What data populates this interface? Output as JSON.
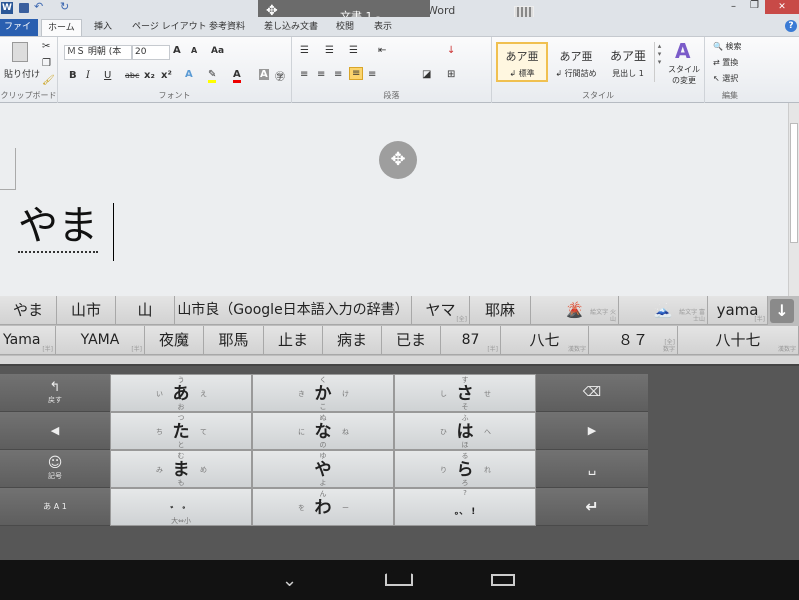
{
  "window": {
    "title": "文書 1 - Microsoft Word",
    "title_shadow": "文書 1 - Microsoft Word",
    "minimize": "–",
    "restore": "❐",
    "close": "✕",
    "help": "?"
  },
  "tabs": [
    {
      "label": "ファイル"
    },
    {
      "label": "ホーム"
    },
    {
      "label": "挿入"
    },
    {
      "label": "ページ レイアウト"
    },
    {
      "label": "参考資料"
    },
    {
      "label": "差し込み文書"
    },
    {
      "label": "校閲"
    },
    {
      "label": "表示"
    }
  ],
  "ribbon": {
    "clipboard": {
      "paste": "貼り付け",
      "label": "クリップボード"
    },
    "font": {
      "name": "ＭＳ 明朝 (本",
      "size": "20",
      "label": "フォント",
      "bold": "B",
      "italic": "I",
      "underline": "U",
      "strike": "abc",
      "sub": "x₂",
      "sup": "x²",
      "case": "Aa",
      "grow": "A",
      "shrink": "A"
    },
    "paragraph": {
      "label": "段落"
    },
    "styles": {
      "items": [
        {
          "sample": "あア亜",
          "name": "↲ 標準"
        },
        {
          "sample": "あア亜",
          "name": "↲ 行間詰め"
        },
        {
          "sample": "あア亜",
          "name": "見出し 1"
        }
      ],
      "change": "スタイルの変更",
      "label": "スタイル"
    },
    "editing": {
      "find": "検索",
      "replace": "置換",
      "select": "選択",
      "label": "編集"
    }
  },
  "document": {
    "text": "やま"
  },
  "candidates": {
    "row1": [
      {
        "text": "やま"
      },
      {
        "text": "山市"
      },
      {
        "text": "山"
      },
      {
        "text": "山市良（Google日本語入力の辞書）"
      },
      {
        "text": "ヤマ",
        "tag": "[全]"
      },
      {
        "text": "耶麻"
      },
      {
        "text": "🌋",
        "tag": "絵文字 火山"
      },
      {
        "text": "🗻",
        "tag": "絵文字 富士山"
      },
      {
        "text": "yama",
        "tag": "[半]"
      }
    ],
    "row2": [
      {
        "text": "Yama",
        "tag": "[半]"
      },
      {
        "text": "YAMA",
        "tag": "[半]"
      },
      {
        "text": "夜魔"
      },
      {
        "text": "耶馬"
      },
      {
        "text": "止ま"
      },
      {
        "text": "病ま"
      },
      {
        "text": "已ま"
      },
      {
        "text": "87",
        "tag": "[半]"
      },
      {
        "text": "八七",
        "tag": "漢数字"
      },
      {
        "text": "８７",
        "tag": "[全] 数字"
      },
      {
        "text": "八十七",
        "tag": "漢数字"
      }
    ]
  },
  "keyboard": {
    "undo": "戻す",
    "symbols": "記号",
    "mode": "あ A 1",
    "keys": [
      {
        "main": "あ",
        "up": "う",
        "left": "い",
        "right": "え",
        "down": "お"
      },
      {
        "main": "か",
        "up": "く",
        "left": "き",
        "right": "け",
        "down": "こ"
      },
      {
        "main": "さ",
        "up": "す",
        "left": "し",
        "right": "せ",
        "down": "そ"
      },
      {
        "main": "た",
        "up": "つ",
        "left": "ち",
        "right": "て",
        "down": "と"
      },
      {
        "main": "な",
        "up": "ぬ",
        "left": "に",
        "right": "ね",
        "down": "の"
      },
      {
        "main": "は",
        "up": "ふ",
        "left": "ひ",
        "right": "へ",
        "down": "ほ"
      },
      {
        "main": "ま",
        "up": "む",
        "left": "み",
        "right": "め",
        "down": "も"
      },
      {
        "main": "や",
        "up": "ゆ",
        "left": "",
        "right": "",
        "down": "よ"
      },
      {
        "main": "ら",
        "up": "る",
        "left": "り",
        "right": "れ",
        "down": "ろ"
      },
      {
        "main": "゛ ゜",
        "up": "",
        "left": "",
        "right": "",
        "down": "大⇔小"
      },
      {
        "main": "わ",
        "up": "ん",
        "left": "を",
        "right": "ー",
        "down": ""
      },
      {
        "main": "。、 !",
        "up": "?",
        "left": "",
        "right": "",
        "down": ""
      }
    ]
  }
}
